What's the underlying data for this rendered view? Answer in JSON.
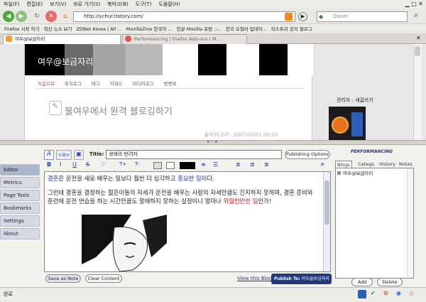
{
  "menu": [
    "파일(F)",
    "편집(E)",
    "보기(V)",
    "바로 가기(S)",
    "북마크(B)",
    "도구(T)",
    "도움말(H)"
  ],
  "url": "http://ychur.tistory.com/",
  "search_placeholder": "Daum",
  "bookmarks": [
    "Firefox 시작 하기",
    "최신 뉴스 보기",
    "ZDNet Korea | All ...",
    "MozillaZine 한국어 ...",
    "한글 Mozilla 포럼 ::...",
    "한국 오질라 업데이...",
    "티스토리 공지 블로그"
  ],
  "tabs": [
    "여우@보금자리",
    "Performancing | Firefox Add-ons | M..."
  ],
  "blog": {
    "title": "여우@보금자리",
    "nav": [
      "처음으로",
      "위치로그",
      "태그",
      "키워드",
      "미디어로그",
      "방명록"
    ],
    "post_title": "불여우에서 원격 블로깅하기",
    "post_meta": "불여우|꼬리 : 2007/03/01 00:05",
    "sidebar_text": "관리자 : 새글쓰기"
  },
  "perf": {
    "title_label": "Title:",
    "title_value": "생애의 반려자",
    "publishing_options": "Publishing Options",
    "logo": "PERFORMANCING",
    "nav": [
      "Editor",
      "Metrics",
      "Page Tools",
      "Bookmarks",
      "Settings",
      "About"
    ],
    "editor": {
      "p1a": "결혼",
      "p1b": "은 운전을 새로 배우는 일보다 훨씬 더 심각하고 ",
      "p1c": "중요한 일",
      "p1d": "이다.",
      "p2a": "그런데 결혼을 결정하는 젊은이들의 자세가 운전을 배우는 사람의 자세만큼도 진지하지 못하며, 결혼 준비와 훈련에 운전 연습을 하는 시간만큼도 할애하지 못하는 실정이니 얼마나 ",
      "p2b": "위험천만한 일",
      "p2c": "인가!"
    },
    "save_note": "Save as Note",
    "clear_content": "Clear Content",
    "view_blog": "View this Blog",
    "publish_to": "Publish To:",
    "publish_target": "여우@보금자리",
    "right_tabs": [
      "Blogs",
      "Categs.",
      "History",
      "Notes"
    ],
    "blog_item": "여우@보금자리",
    "add": "Add",
    "delete": "Delete"
  },
  "status": "완료",
  "colors": {
    "blue": "#1a3bcc",
    "red": "#d81e1e",
    "navy": "#23377a"
  }
}
